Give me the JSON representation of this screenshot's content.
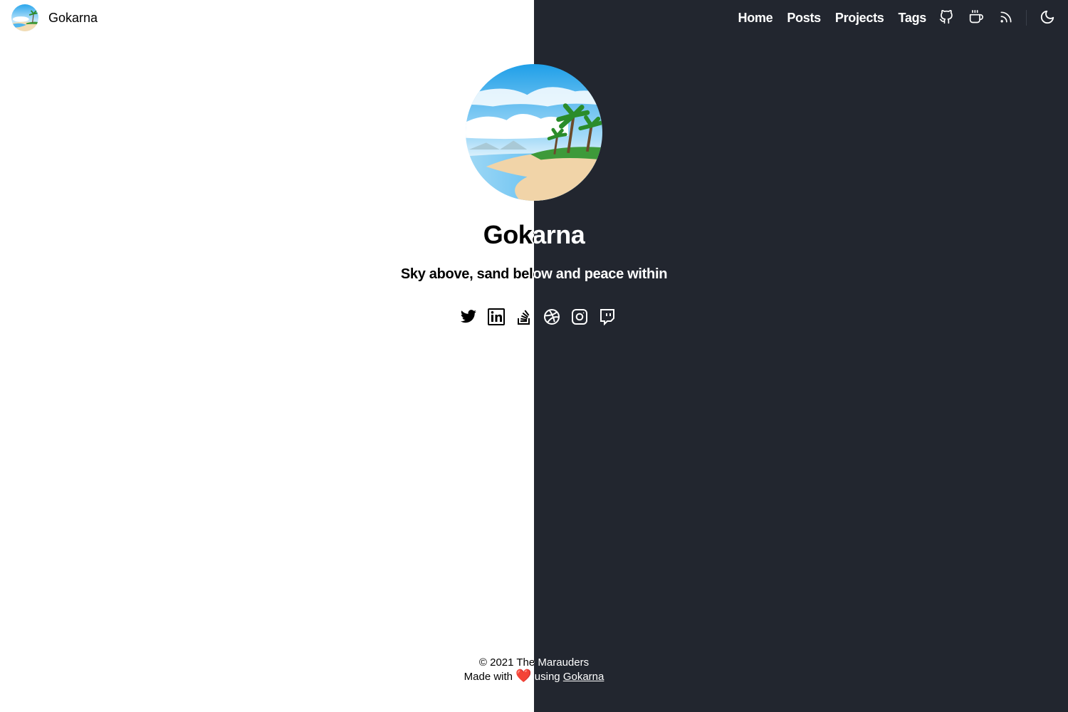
{
  "header": {
    "site_name": "Gokarna",
    "nav": [
      "Home",
      "Posts",
      "Projects",
      "Tags"
    ],
    "nav_icons": [
      "github-icon",
      "coffee-icon",
      "rss-icon"
    ],
    "theme_toggle_icon": "moon-icon"
  },
  "hero": {
    "title": "Gokarna",
    "subtitle": "Sky above, sand below and peace within",
    "social_icons": [
      "twitter-icon",
      "linkedin-icon",
      "stackoverflow-icon",
      "dribbble-icon",
      "instagram-icon",
      "twitch-icon"
    ]
  },
  "footer": {
    "copyright": "© 2021 The Marauders",
    "made_with": "Made with",
    "heart": "❤️",
    "using": "using",
    "link_text": "Gokarna"
  },
  "colors": {
    "light_bg": "#ffffff",
    "dark_bg": "#22262f",
    "heart": "#e0202e"
  }
}
